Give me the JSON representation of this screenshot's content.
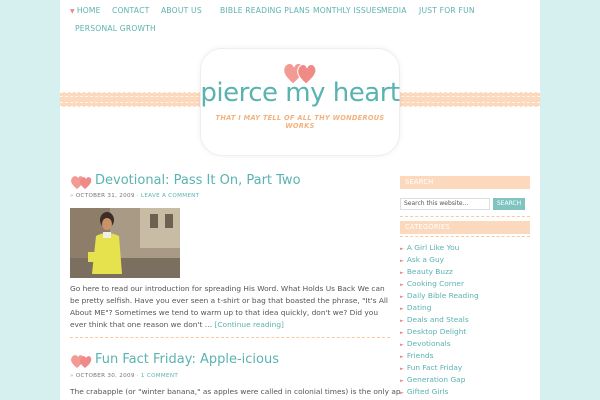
{
  "nav": {
    "items": [
      "HOME",
      "CONTACT",
      "ABOUT US",
      "BIBLE READING PLANS",
      "MONTHLY ISSUES",
      "MEDIA",
      "JUST FOR FUN",
      "PERSONAL GROWTH"
    ]
  },
  "header": {
    "title": "pierce my heart",
    "tagline": "THAT I MAY TELL OF ALL THY WONDEROUS WORKS"
  },
  "posts": [
    {
      "title": "Devotional: Pass It On, Part Two",
      "date": "OCTOBER 31, 2009",
      "comment_link": "LEAVE A COMMENT",
      "excerpt": "Go here to read our introduction for spreading His Word. What Holds Us Back We can be pretty selfish. Have you ever seen a t-shirt or bag that boasted the phrase, \"It's All About ME\"? Sometimes we tend to warm up to that idea quickly, don't we? Did you ever think that one reason we don't …",
      "more": "[Continue reading]"
    },
    {
      "title": "Fun Fact Friday: Apple-icious",
      "date": "OCTOBER 30, 2009",
      "comment_link": "1 COMMENT",
      "excerpt": "The crabapple (or \"winter banana,\" as apples were called in colonial times) is the only apple"
    }
  ],
  "sidebar": {
    "search_heading": "SEARCH",
    "search_placeholder": "Search this website...",
    "search_button": "SEARCH",
    "categories_heading": "CATEGORIES",
    "categories": [
      "A Girl Like You",
      "Ask a Guy",
      "Beauty Buzz",
      "Cooking Corner",
      "Daily Bible Reading",
      "Dating",
      "Deals and Steals",
      "Desktop Delight",
      "Devotionals",
      "Friends",
      "Fun Fact Friday",
      "Generation Gap",
      "Gifted Girls"
    ]
  },
  "colors": {
    "accent_teal": "#5ab3b0",
    "accent_peach": "#fcd9bd",
    "heart_pink": "#e98a8a",
    "page_bg": "#d6efef"
  }
}
